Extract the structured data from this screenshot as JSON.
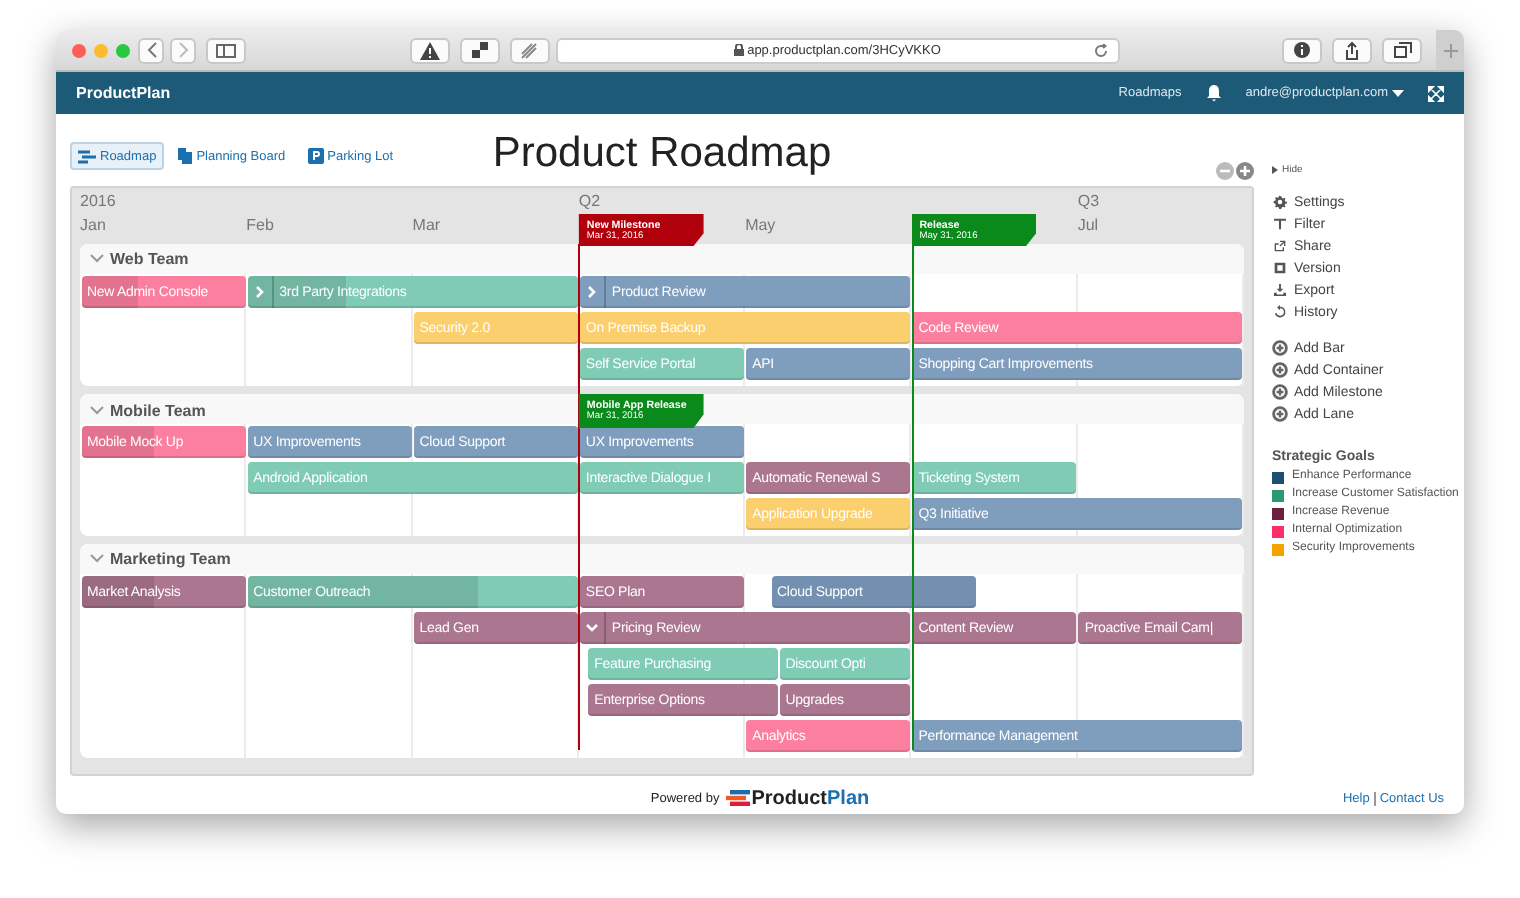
{
  "browser": {
    "url": "app.productplan.com/3HCyVKKO"
  },
  "app_bar": {
    "brand": "ProductPlan",
    "nav": "Roadmaps",
    "user": "andre@productplan.com"
  },
  "views": [
    {
      "label": "Roadmap",
      "selected": true
    },
    {
      "label": "Planning Board",
      "selected": false
    },
    {
      "label": "Parking Lot",
      "selected": false
    }
  ],
  "title": "Product Roadmap",
  "timeline": {
    "periods": [
      "2016",
      "Q2",
      "Q3"
    ],
    "months": [
      "Jan",
      "Feb",
      "Mar",
      "May",
      "Jul"
    ],
    "milestones": [
      {
        "name": "New Milestone",
        "date": "Mar 31, 2016",
        "color": "#b0000c"
      },
      {
        "name": "Release",
        "date": "May 31, 2016",
        "color": "#0b8a1c"
      }
    ]
  },
  "lanes": [
    {
      "name": "Web Team",
      "expanded": true,
      "rows": [
        {
          "bars": [
            {
              "label": "New Admin Console",
              "kind": "bar",
              "color": "#fc7f9f",
              "level": 0.35
            },
            {
              "label": "3rd Party Integrations",
              "kind": "container",
              "expanded": false,
              "color": "#7fcbb4",
              "level": 0.3
            },
            {
              "label": "Product Review",
              "kind": "container",
              "expanded": false,
              "color": "#7f9dbd"
            }
          ]
        },
        {
          "bars": [
            {
              "label": "Security 2.0",
              "kind": "bar",
              "color": "#fbce6e"
            },
            {
              "label": "On Premise Backup",
              "kind": "bar",
              "color": "#fbce6e"
            },
            {
              "label": "Code Review",
              "kind": "bar",
              "color": "#fc7f9f"
            }
          ]
        },
        {
          "bars": [
            {
              "label": "Self Service Portal",
              "kind": "bar",
              "color": "#7fcbb4"
            },
            {
              "label": "API",
              "kind": "bar",
              "color": "#7f9dbd"
            },
            {
              "label": "Shopping Cart Improvements",
              "kind": "bar",
              "color": "#7f9dbd"
            }
          ]
        }
      ]
    },
    {
      "name": "Mobile Team",
      "expanded": true,
      "milestones": [
        {
          "name": "Mobile App Release",
          "date": "Mar 31, 2016",
          "color": "#0b8a1c"
        }
      ],
      "rows": [
        {
          "bars": [
            {
              "label": "Mobile Mock Up",
              "kind": "bar",
              "color": "#fc7f9f",
              "level": 0.45
            },
            {
              "label": "UX Improvements",
              "kind": "bar",
              "color": "#7f9dbd"
            },
            {
              "label": "Cloud Support",
              "kind": "bar",
              "color": "#7f9dbd"
            },
            {
              "label": "UX Improvements",
              "kind": "bar",
              "color": "#7f9dbd"
            }
          ]
        },
        {
          "bars": [
            {
              "label": "Android Application",
              "kind": "bar",
              "color": "#7fcbb4"
            },
            {
              "label": "Interactive Dialogue I",
              "kind": "bar",
              "color": "#7fcbb4"
            },
            {
              "label": "Automatic Renewal S",
              "kind": "bar",
              "color": "#ab7690"
            },
            {
              "label": "Ticketing System",
              "kind": "bar",
              "color": "#7fcbb4"
            }
          ]
        },
        {
          "bars": [
            {
              "label": "Application Upgrade",
              "kind": "bar",
              "color": "#fbce6e"
            },
            {
              "label": "Q3 Initiative",
              "kind": "bar",
              "color": "#7f9dbd"
            }
          ]
        }
      ]
    },
    {
      "name": "Marketing Team",
      "expanded": true,
      "rows": [
        {
          "bars": [
            {
              "label": "Market Analysis",
              "kind": "bar",
              "color": "#ab7690",
              "level": 0.45
            },
            {
              "label": "Customer Outreach",
              "kind": "bar",
              "color": "#7fcbb4",
              "level": 0.7
            },
            {
              "label": "SEO Plan",
              "kind": "bar",
              "color": "#ab7690"
            },
            {
              "label": "Cloud Support",
              "kind": "bar",
              "color": "#7490b0"
            }
          ]
        },
        {
          "bars": [
            {
              "label": "Lead Gen",
              "kind": "bar",
              "color": "#ab7690"
            },
            {
              "label": "Pricing Review",
              "kind": "container",
              "expanded": true,
              "color": "#ab7690"
            },
            {
              "label": "Content Review",
              "kind": "bar",
              "color": "#ab7690"
            },
            {
              "label": "Proactive Email Cam|",
              "kind": "bar",
              "color": "#ab7690"
            }
          ]
        },
        {
          "bars": [
            {
              "label": "Feature Purchasing",
              "kind": "bar",
              "color": "#7fcbb4"
            },
            {
              "label": "Discount Opti",
              "kind": "bar",
              "color": "#7fcbb4"
            }
          ]
        },
        {
          "bars": [
            {
              "label": "Enterprise Options",
              "kind": "bar",
              "color": "#ab7690"
            },
            {
              "label": "Upgrades",
              "kind": "bar",
              "color": "#ab7690"
            }
          ]
        },
        {
          "bars": [
            {
              "label": "Analytics",
              "kind": "bar",
              "color": "#fc7f9f"
            },
            {
              "label": "Performance Management",
              "kind": "bar",
              "color": "#7f9dbd"
            }
          ]
        }
      ]
    }
  ],
  "sidebar": {
    "hide": "Hide",
    "actions": [
      "Settings",
      "Filter",
      "Share",
      "Version",
      "Export",
      "History"
    ],
    "add_actions": [
      "Add Bar",
      "Add Container",
      "Add Milestone",
      "Add Lane"
    ],
    "legend_title": "Strategic Goals",
    "legend": [
      {
        "label": "Enhance Performance",
        "color": "#1e4f73"
      },
      {
        "label": "Increase Customer Satisfaction",
        "color": "#2a9a72"
      },
      {
        "label": "Increase Revenue",
        "color": "#6b2040"
      },
      {
        "label": "Internal Optimization",
        "color": "#ff2d6a"
      },
      {
        "label": "Security Improvements",
        "color": "#f5a100"
      }
    ]
  },
  "footer": {
    "powered": "Powered by",
    "logo_word": "Product",
    "logo_accent": "Plan",
    "links": [
      "Help",
      "Contact Us"
    ]
  }
}
